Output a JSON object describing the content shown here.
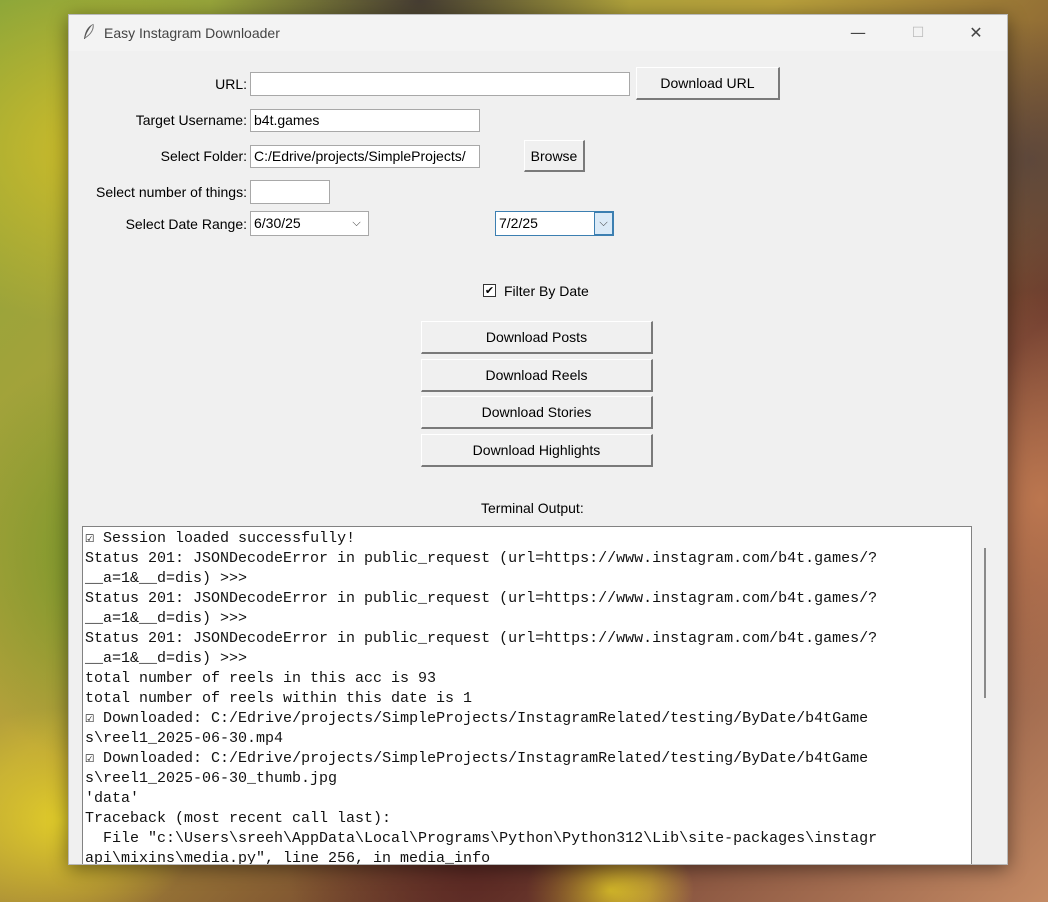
{
  "window": {
    "title": "Easy Instagram Downloader",
    "minimize": "—",
    "maximize": "☐",
    "close": "✕"
  },
  "form": {
    "url_label": "URL:",
    "url_value": "",
    "download_url_button": "Download URL",
    "username_label": "Target Username:",
    "username_value": "b4t.games",
    "folder_label": "Select Folder:",
    "folder_value": "C:/Edrive/projects/SimpleProjects/",
    "browse_button": "Browse",
    "count_label": "Select number of things:",
    "count_value": "",
    "date_label": "Select Date Range:",
    "date_start": "6/30/25",
    "date_end": "7/2/25",
    "filter_label": "Filter By Date",
    "filter_checked": true,
    "download_posts": "Download Posts",
    "download_reels": "Download Reels",
    "download_stories": "Download Stories",
    "download_highlights": "Download Highlights"
  },
  "terminal": {
    "title": "Terminal Output:",
    "lines": [
      "☑ Session loaded successfully!",
      "Status 201: JSONDecodeError in public_request (url=https://www.instagram.com/b4t.games/?",
      "__a=1&__d=dis) >>>",
      "Status 201: JSONDecodeError in public_request (url=https://www.instagram.com/b4t.games/?",
      "__a=1&__d=dis) >>>",
      "Status 201: JSONDecodeError in public_request (url=https://www.instagram.com/b4t.games/?",
      "__a=1&__d=dis) >>>",
      "total number of reels in this acc is 93",
      "total number of reels within this date is 1",
      "☑ Downloaded: C:/Edrive/projects/SimpleProjects/InstagramRelated/testing/ByDate/b4tGame",
      "s\\reel1_2025-06-30.mp4",
      "☑ Downloaded: C:/Edrive/projects/SimpleProjects/InstagramRelated/testing/ByDate/b4tGame",
      "s\\reel1_2025-06-30_thumb.jpg",
      "'data'",
      "Traceback (most recent call last):",
      "  File \"c:\\Users\\sreeh\\AppData\\Local\\Programs\\Python\\Python312\\Lib\\site-packages\\instagr",
      "api\\mixins\\media.py\", line 256, in media_info"
    ]
  }
}
